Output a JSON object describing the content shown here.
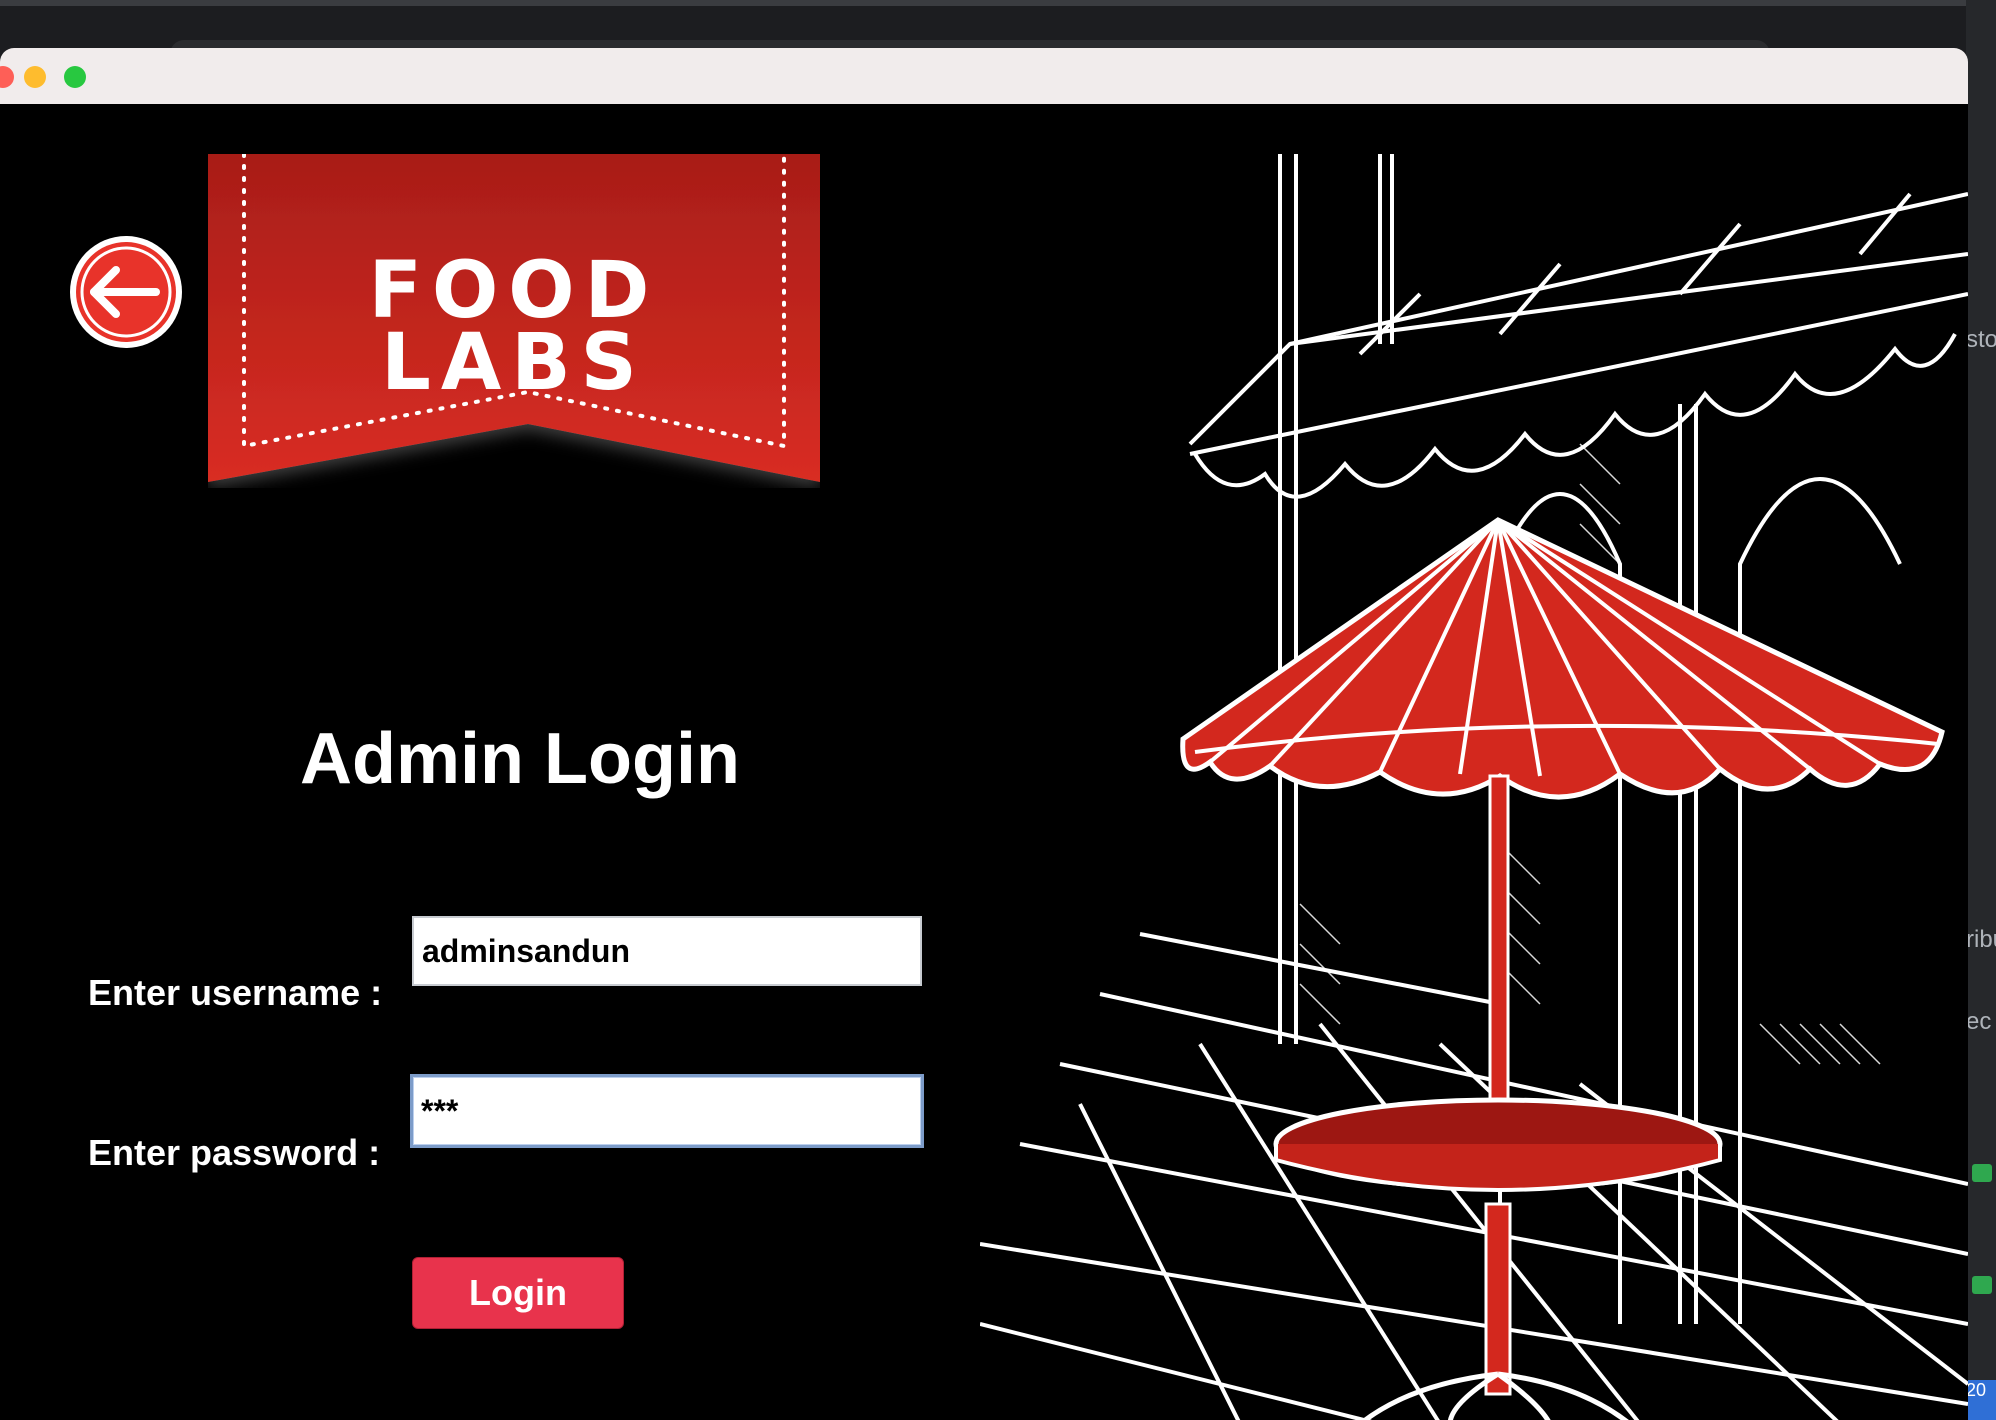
{
  "window": {
    "traffic_lights": [
      "close",
      "minimize",
      "zoom"
    ]
  },
  "logo": {
    "line1": "FOOD",
    "line2": "LABS",
    "ribbon_color": "#d1271f"
  },
  "login": {
    "title": "Admin Login",
    "username_label": "Enter username :",
    "username_value": "adminsandun",
    "password_label": "Enter password :",
    "password_value": "***",
    "button_label": "Login",
    "button_color": "#e8334c"
  },
  "background_peek": {
    "text1": "sto",
    "text2": "ribu",
    "text3": "ec",
    "text4": "20"
  },
  "colors": {
    "accent_red": "#d1271f",
    "background": "#000000"
  }
}
